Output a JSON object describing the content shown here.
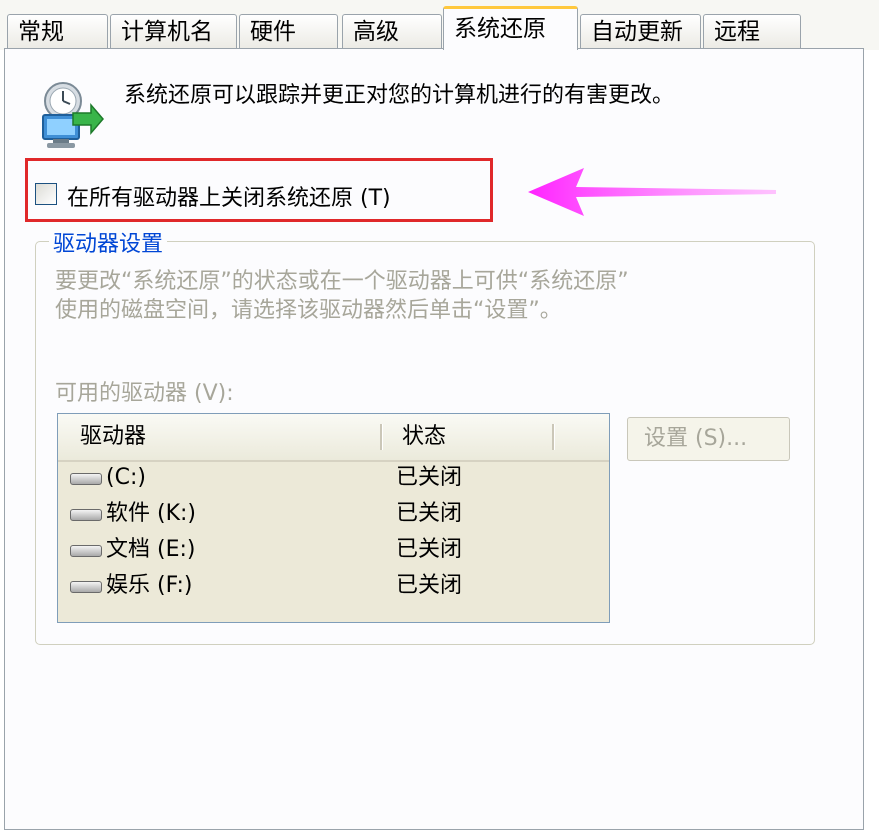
{
  "tabs": [
    {
      "label": "常规",
      "active": false
    },
    {
      "label": "计算机名",
      "active": false
    },
    {
      "label": "硬件",
      "active": false
    },
    {
      "label": "高级",
      "active": false
    },
    {
      "label": "系统还原",
      "active": true
    },
    {
      "label": "自动更新",
      "active": false
    },
    {
      "label": "远程",
      "active": false
    }
  ],
  "header": {
    "icon": "system-restore-icon",
    "description": "系统还原可以跟踪并更正对您的计算机进行的有害更改。"
  },
  "turn_off_option": {
    "label": "在所有驱动器上关闭系统还原 (T)",
    "checked": false
  },
  "drive_settings": {
    "title": "驱动器设置",
    "info_line1": "要更改“系统还原”的状态或在一个驱动器上可供“系统还原”",
    "info_line2": "使用的磁盘空间，请选择该驱动器然后单击“设置”。",
    "available_label": "可用的驱动器 (V):",
    "columns": [
      "驱动器",
      "状态"
    ],
    "drives": [
      {
        "name": " (C:)",
        "status": "已关闭"
      },
      {
        "name": "软件 (K:)",
        "status": "已关闭"
      },
      {
        "name": "文档 (E:)",
        "status": "已关闭"
      },
      {
        "name": "娱乐 (F:)",
        "status": "已关闭"
      }
    ],
    "settings_button": "设置 (S)..."
  },
  "colors": {
    "highlight": "#e0282a",
    "arrow": "#ff33ff",
    "group_title": "#0046d5",
    "disabled_text": "#a7a69a"
  }
}
